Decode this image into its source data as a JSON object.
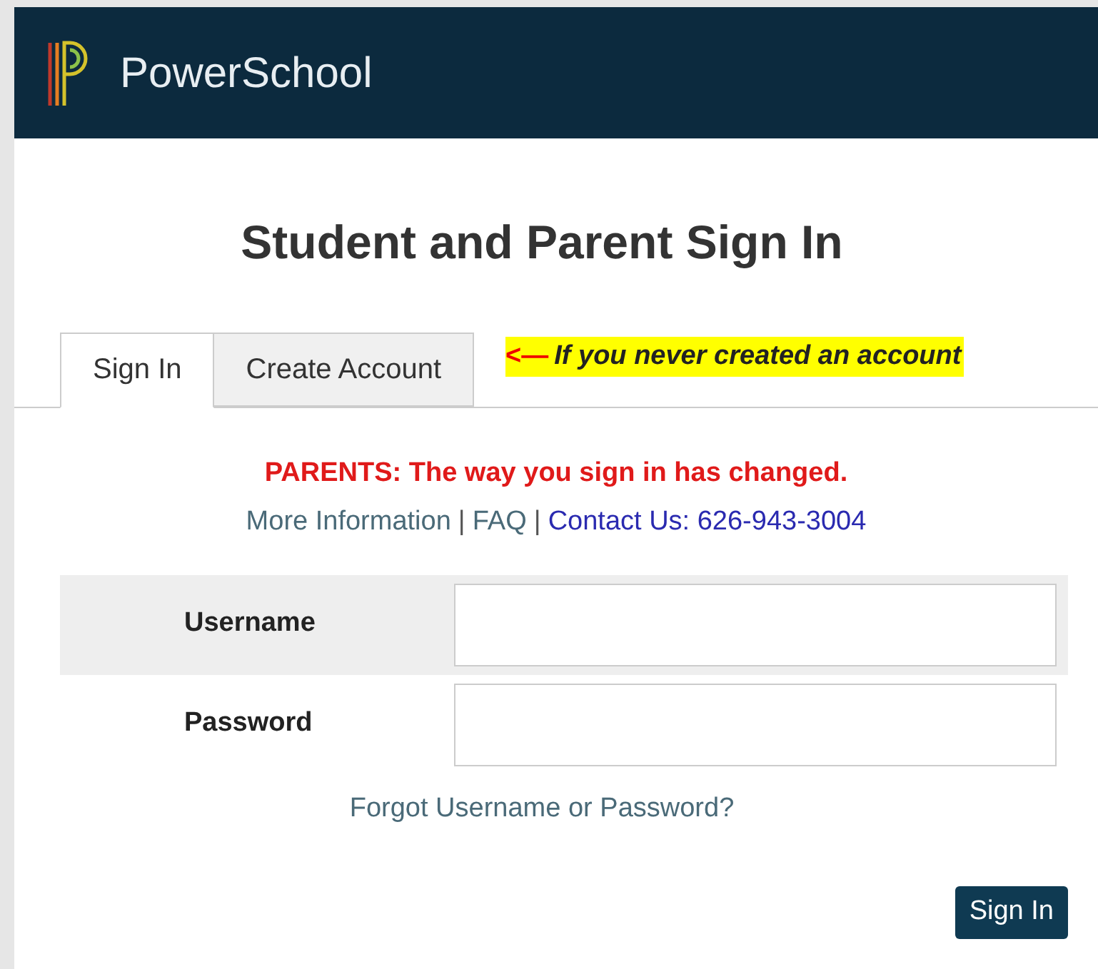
{
  "header": {
    "brand": "PowerSchool"
  },
  "title": "Student and Parent Sign In",
  "tabs": [
    {
      "label": "Sign In",
      "selected": true
    },
    {
      "label": "Create Account",
      "selected": false
    }
  ],
  "note": {
    "arrow": "<—",
    "text": "If you never created an account"
  },
  "alert": "PARENTS: The way you sign in has changed.",
  "links": [
    {
      "kind": "link",
      "text": "More Information",
      "color": "#4a6a78"
    },
    {
      "kind": "separator",
      "text": "|"
    },
    {
      "kind": "link",
      "text": "FAQ",
      "color": "#4a6a78"
    },
    {
      "kind": "separator",
      "text": "|"
    },
    {
      "kind": "link",
      "text": "Contact Us: 626-943-3004",
      "color": "#2a2ab0"
    }
  ],
  "fields": [
    {
      "label": "Username",
      "shaded": true
    },
    {
      "label": "Password",
      "shaded": false
    }
  ],
  "forgot_link": "Forgot Username or Password?",
  "submit_button": "Sign In"
}
